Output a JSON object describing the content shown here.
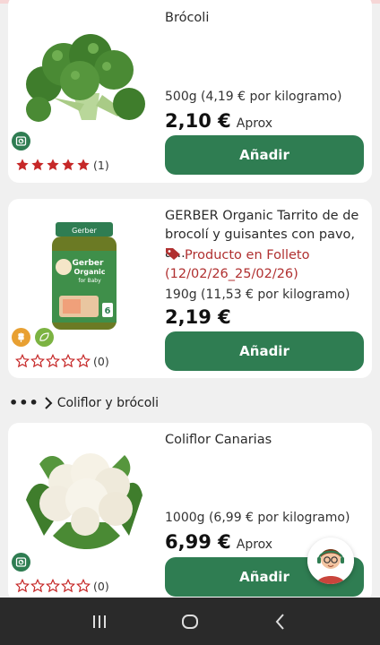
{
  "colors": {
    "brand_green": "#2f7d52",
    "star_red": "#c62828",
    "promo_red": "#b03030"
  },
  "products": [
    {
      "title": "Brócoli",
      "weight": "500g (4,19 € por kilogramo)",
      "price": "2,10 €",
      "approx": "Aprox",
      "add_label": "Añadir",
      "rating": 5,
      "rating_count": "(1)",
      "badges": [
        "scale-icon"
      ]
    },
    {
      "title": "GERBER Organic Tarrito de de brocolí y guisantes con pavo, a...",
      "promo_label": "Producto en Folleto",
      "promo_dates": "(12/02/26_25/02/26)",
      "weight": "190g (11,53 € por kilogramo)",
      "price": "2,19 €",
      "add_label": "Añadir",
      "rating": 0,
      "rating_count": "(0)",
      "badges": [
        "wheat-free-icon",
        "organic-leaf-icon"
      ],
      "jar_text": {
        "brand": "Gerber",
        "line1": "Gerber",
        "line2": "Organic",
        "line3": "for Baby",
        "age": "6"
      }
    },
    {
      "title": "Coliflor Canarias",
      "weight": "1000g (6,99 € por kilogramo)",
      "price": "6,99 €",
      "approx": "Aprox",
      "add_label": "Añadir",
      "rating": 0,
      "rating_count": "(0)",
      "badges": [
        "scale-icon"
      ]
    }
  ],
  "breadcrumb": {
    "label": "Coliflor y brócoli"
  }
}
